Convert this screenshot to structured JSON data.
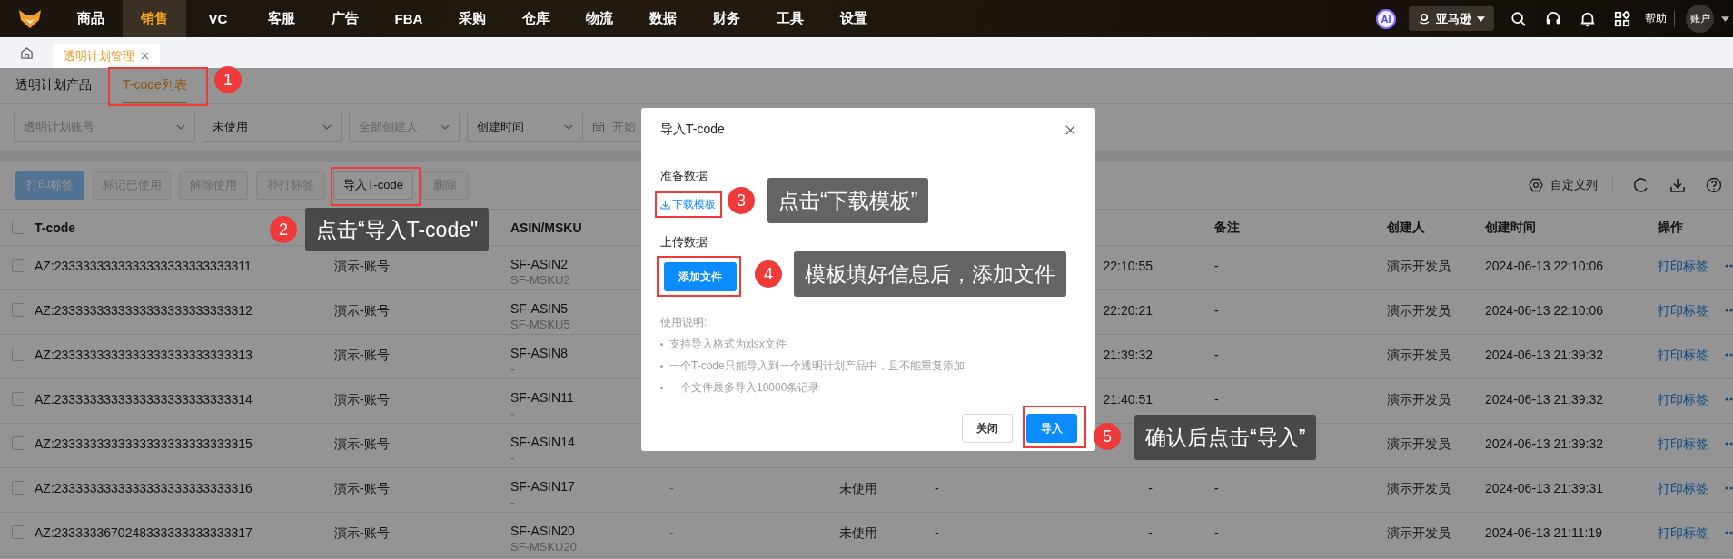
{
  "nav": {
    "items": [
      {
        "label": "商品",
        "selected": false
      },
      {
        "label": "销售",
        "selected": true
      },
      {
        "label": "VC",
        "selected": false
      },
      {
        "label": "客服",
        "selected": false
      },
      {
        "label": "广告",
        "selected": false
      },
      {
        "label": "FBA",
        "selected": false
      },
      {
        "label": "采购",
        "selected": false
      },
      {
        "label": "仓库",
        "selected": false
      },
      {
        "label": "物流",
        "selected": false
      },
      {
        "label": "数据",
        "selected": false
      },
      {
        "label": "财务",
        "selected": false
      },
      {
        "label": "工具",
        "selected": false
      },
      {
        "label": "设置",
        "selected": false
      }
    ],
    "ai_badge": "AI",
    "marketplace": "亚马逊",
    "help": "帮助",
    "account": "账户"
  },
  "page_tabs": [
    {
      "label": "透明计划管理",
      "selected": true
    }
  ],
  "sub_tabs": [
    {
      "label": "透明计划产品",
      "selected": false
    },
    {
      "label": "T-code列表",
      "selected": true
    }
  ],
  "filters": [
    {
      "kind": "select",
      "placeholder": "透明计划账号"
    },
    {
      "kind": "select",
      "value": "未使用"
    },
    {
      "kind": "select",
      "placeholder": "全部创建人"
    },
    {
      "kind": "select",
      "value": "创建时间"
    },
    {
      "kind": "date",
      "placeholder": "开始"
    }
  ],
  "toolbar": {
    "buttons": [
      {
        "label": "打印标签",
        "kind": "primary",
        "disabled": true
      },
      {
        "label": "标记已使用",
        "kind": "default",
        "disabled": true
      },
      {
        "label": "解除使用",
        "kind": "default",
        "disabled": true
      },
      {
        "label": "补打标签",
        "kind": "default",
        "disabled": true
      },
      {
        "label": "导入T-code",
        "kind": "default",
        "disabled": false
      },
      {
        "label": "删除",
        "kind": "default",
        "disabled": true
      }
    ],
    "customize_columns": "自定义列"
  },
  "table": {
    "headers": {
      "t_code": "T-code",
      "asin_msku": "ASIN/MSKU",
      "remark": "备注",
      "creator": "创建人",
      "created_time": "创建时间",
      "actions": "操作"
    },
    "all_checked": false,
    "rows": [
      {
        "checked": false,
        "t_code": "AZ:2333333333333333333333333311",
        "column_2": "演示-账号",
        "asin": "SF-ASIN2",
        "msku": "SF-MSKU2",
        "column_7": "22:10:55",
        "remark": "-",
        "creator": "演示开发员",
        "created_time": "2024-06-13 22:10:06",
        "action": "打印标签"
      },
      {
        "checked": false,
        "t_code": "AZ:2333333333333333333333333312",
        "column_2": "演示-账号",
        "asin": "SF-ASIN5",
        "msku": "SF-MSKU5",
        "column_7": "22:20:21",
        "remark": "-",
        "creator": "演示开发员",
        "created_time": "2024-06-13 22:10:06",
        "action": "打印标签"
      },
      {
        "checked": false,
        "t_code": "AZ:2333333333333333333333333313",
        "column_2": "演示-账号",
        "asin": "SF-ASIN8",
        "msku": "-",
        "column_7": "21:39:32",
        "remark": "-",
        "creator": "演示开发员",
        "created_time": "2024-06-13 21:39:32",
        "action": "打印标签"
      },
      {
        "checked": false,
        "t_code": "AZ:2333333333333333333333333314",
        "column_2": "演示-账号",
        "asin": "SF-ASIN11",
        "msku": "-",
        "column_7": "21:40:51",
        "remark": "-",
        "creator": "演示开发员",
        "created_time": "2024-06-13 21:39:32",
        "action": "打印标签"
      },
      {
        "checked": false,
        "t_code": "AZ:2333333333333333333333333315",
        "column_2": "演示-账号",
        "asin": "SF-ASIN14",
        "msku": "-",
        "creator": "演示开发员",
        "created_time": "2024-06-13 21:39:32",
        "action": "打印标签"
      },
      {
        "checked": false,
        "t_code": "AZ:2333333333333333333333333316",
        "column_2": "演示-账号",
        "asin": "SF-ASIN17",
        "msku": "-",
        "column_4": "-",
        "column_5": "未使用",
        "column_6": "-",
        "column_7": "-",
        "remark": "-",
        "creator": "演示开发员",
        "created_time": "2024-06-13 21:39:31",
        "action": "打印标签"
      },
      {
        "checked": false,
        "t_code": "AZ:2333333670248333333333333317",
        "column_2": "演示-账号",
        "asin": "SF-ASIN20",
        "msku": "SF-MSKU20",
        "column_4": "-",
        "column_5": "未使用",
        "column_6": "-",
        "column_7": "-",
        "remark": "-",
        "creator": "演示开发员",
        "created_time": "2024-06-13 21:11:19",
        "action": "打印标签"
      }
    ]
  },
  "dialog": {
    "title": "导入T-code",
    "prepare_label": "准备数据",
    "download_link": "下载模板",
    "upload_label": "上传数据",
    "add_file_button": "添加文件",
    "notes_title": "使用说明:",
    "notes": [
      "支持导入格式为xlsx文件",
      "一个T-code只能导入到一个透明计划产品中，且不能重复添加",
      "一个文件最多导入10000条记录"
    ],
    "buttons": [
      {
        "label": "关闭",
        "kind": "default"
      },
      {
        "label": "导入",
        "kind": "primary"
      }
    ]
  },
  "annotations": [
    {
      "number": "1"
    },
    {
      "number": "2",
      "text": "点击“导入T-code\""
    },
    {
      "number": "3",
      "text": "点击“下载模板”"
    },
    {
      "number": "4",
      "text": "模板填好信息后，添加文件"
    },
    {
      "number": "5",
      "text": "确认后点击“导入”"
    }
  ]
}
